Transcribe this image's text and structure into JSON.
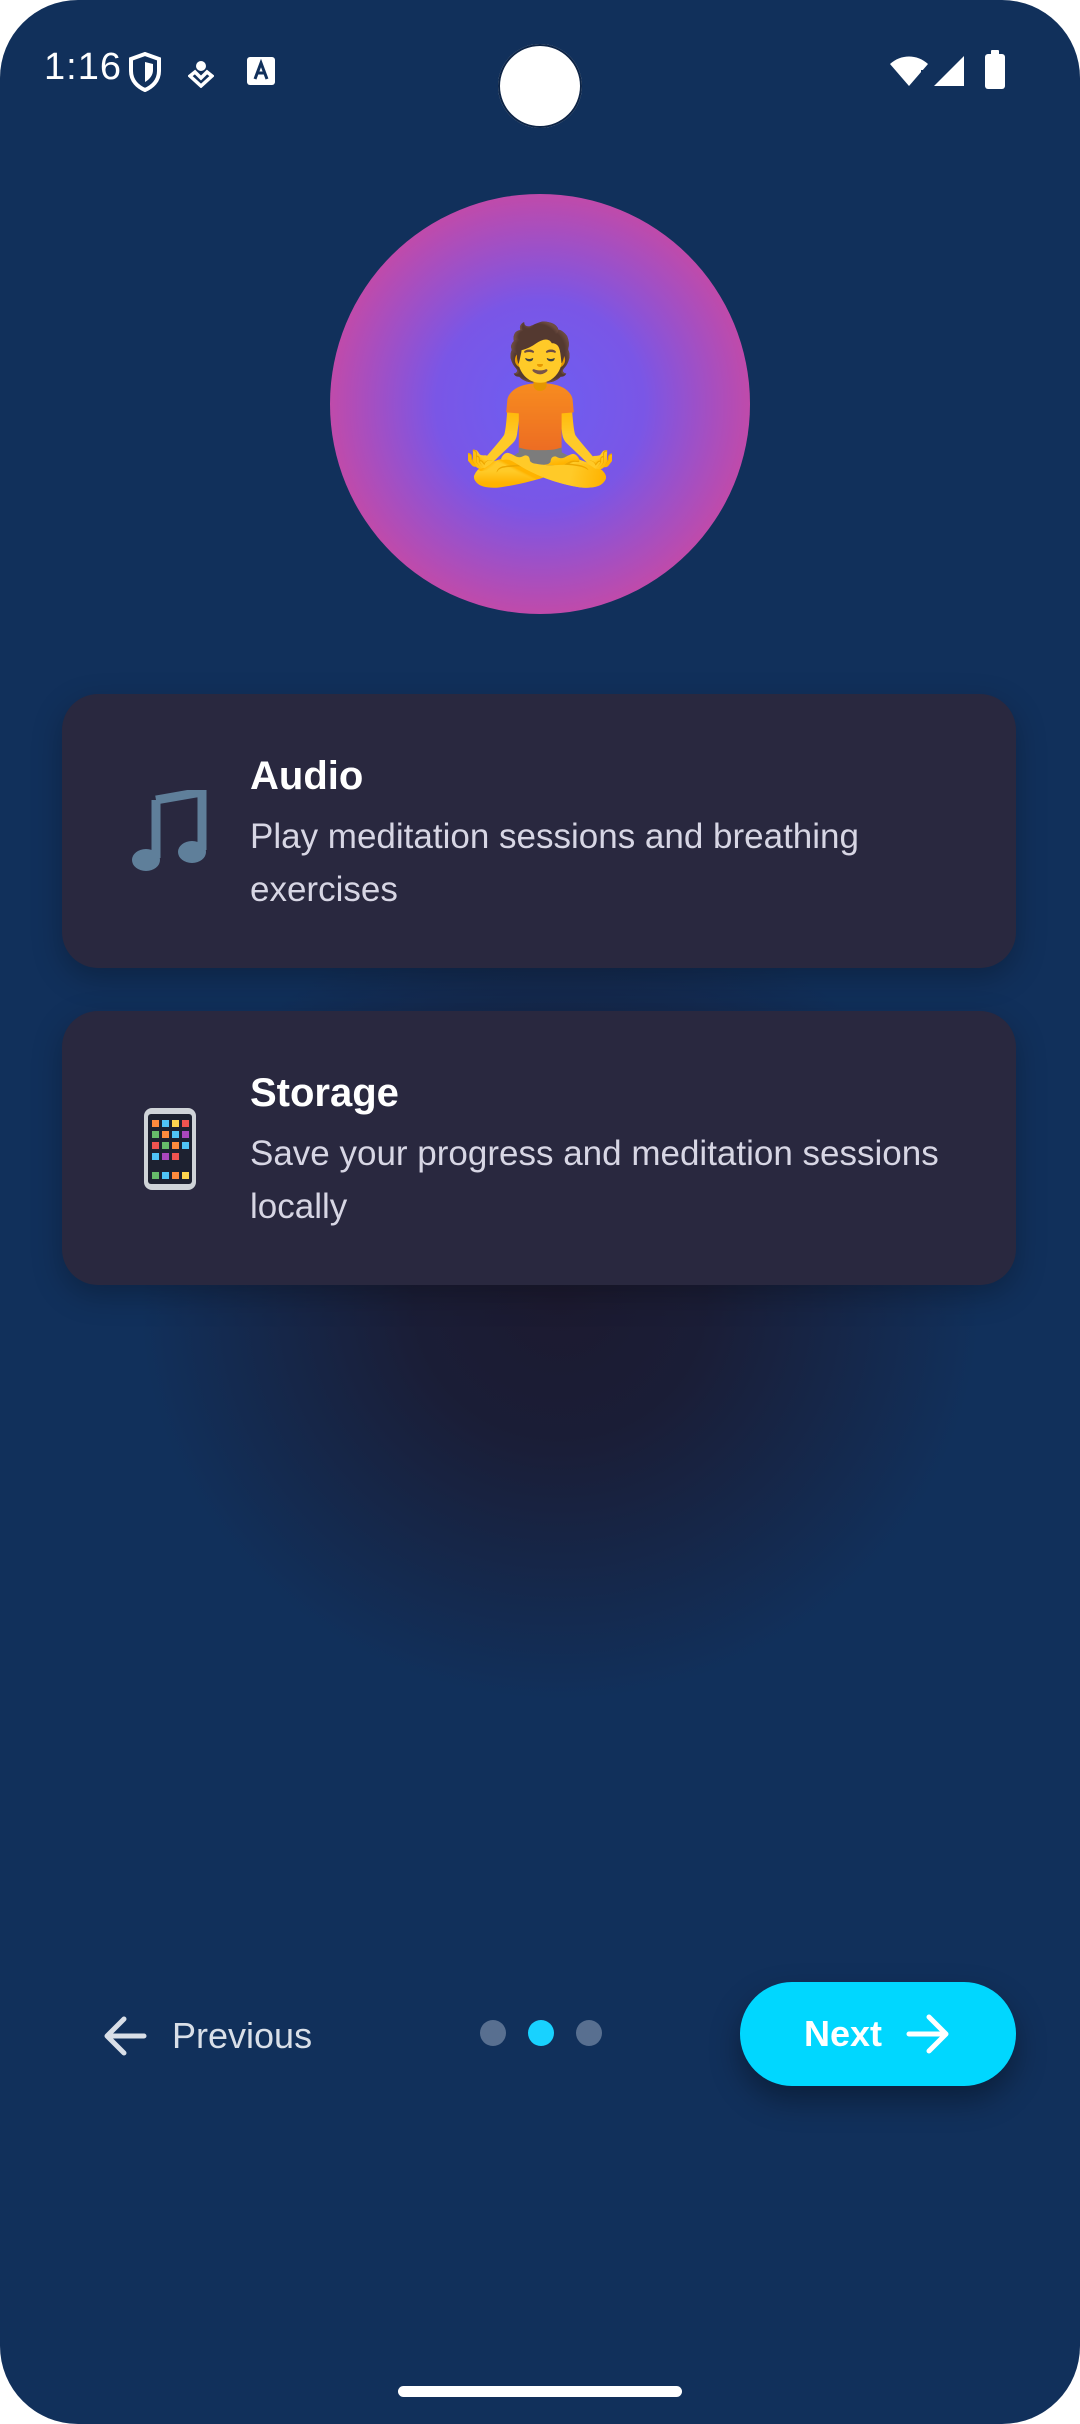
{
  "status_bar": {
    "time": "1:16",
    "icons": [
      "shield-icon",
      "location-pin-icon",
      "text-a-icon",
      "wifi-icon",
      "signal-icon",
      "battery-icon"
    ]
  },
  "hero": {
    "emoji": "🧘",
    "icon": "meditation-person-icon"
  },
  "permissions": [
    {
      "icon": "music-note-icon",
      "emoji": "🎵",
      "title": "Audio",
      "description": "Play meditation sessions and breathing exercises"
    },
    {
      "icon": "mobile-phone-icon",
      "emoji": "📱",
      "title": "Storage",
      "description": "Save your progress and meditation sessions locally"
    }
  ],
  "navigation": {
    "previous_label": "Previous",
    "next_label": "Next",
    "page_count": 3,
    "current_page": 2
  },
  "colors": {
    "background": "#11305b",
    "card": "#29283f",
    "accent": "#00d7ff",
    "dot_inactive": "#586f90"
  }
}
